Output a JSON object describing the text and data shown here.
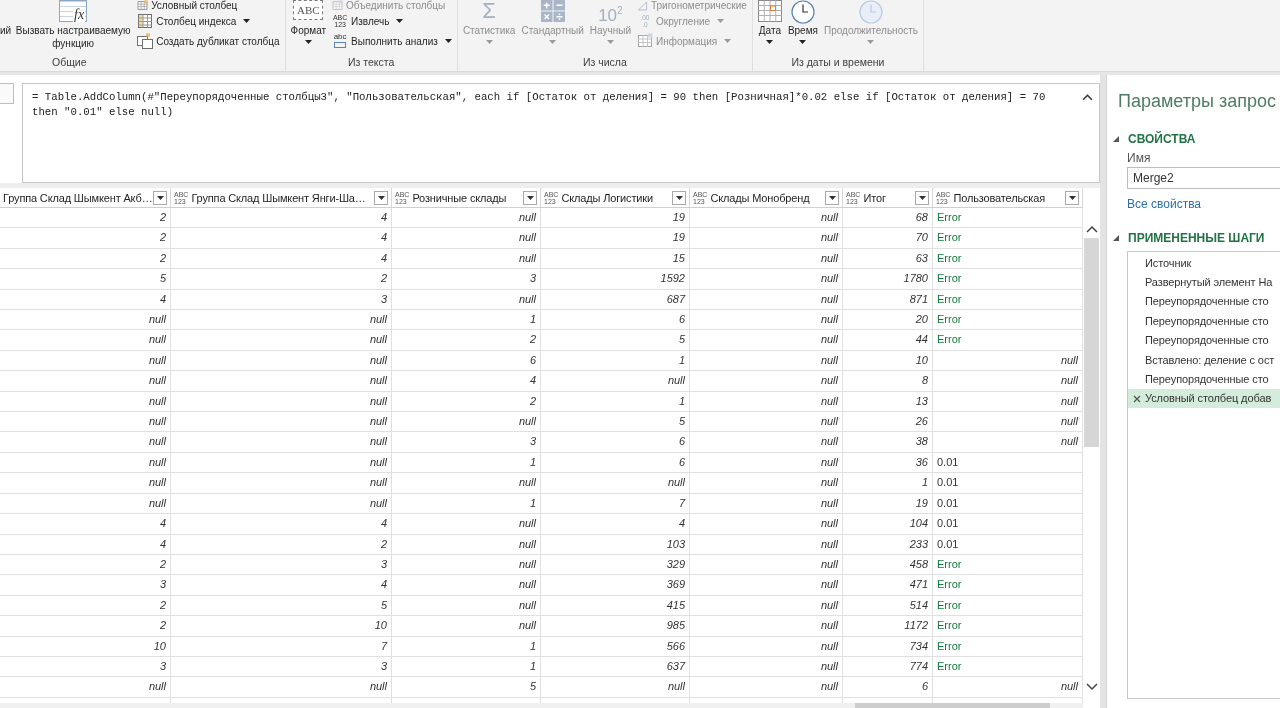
{
  "ribbon": {
    "groups": [
      {
        "label": "Общие",
        "cut_label": "ий",
        "large": [
          {
            "label": "Вызвать настраиваемую функцию",
            "disabled": false,
            "dropdown": false,
            "icon_text": [
              "fx"
            ]
          }
        ],
        "small": [
          {
            "label": "Условный столбец",
            "disabled": false,
            "dropdown": false
          },
          {
            "label": "Столбец индекса",
            "disabled": false,
            "dropdown": true
          },
          {
            "label": "Создать дубликат столбца",
            "disabled": false,
            "dropdown": false
          }
        ]
      },
      {
        "label": "Из текста",
        "large": [
          {
            "label": "Формат",
            "disabled": false,
            "dropdown": true,
            "icon_text": [
              "ABC"
            ]
          }
        ],
        "small": [
          {
            "label": "Объединить столбцы",
            "disabled": true,
            "dropdown": false
          },
          {
            "label": "Извлечь",
            "disabled": false,
            "dropdown": true,
            "icon_text": [
              "ABC",
              "123"
            ]
          },
          {
            "label": "Выполнить анализ",
            "disabled": false,
            "dropdown": true,
            "icon_text": [
              "abc"
            ]
          }
        ]
      },
      {
        "label": "Из числа",
        "large": [
          {
            "label": "Статистика",
            "disabled": true,
            "dropdown": true,
            "icon_text": [
              "Σ"
            ]
          },
          {
            "label": "Стандартный",
            "disabled": true,
            "dropdown": true
          },
          {
            "label": "Научный",
            "disabled": true,
            "dropdown": true,
            "icon_text": [
              "10$^{2}$"
            ]
          }
        ],
        "small": [
          {
            "label": "Тригонометрические",
            "disabled": true,
            "dropdown": false
          },
          {
            "label": "Округление",
            "disabled": true,
            "dropdown": true,
            "icon_text": [
              ".00",
              ".0"
            ]
          },
          {
            "label": "Информация",
            "disabled": true,
            "dropdown": true
          }
        ]
      },
      {
        "label": "Из даты и времени",
        "large": [
          {
            "label": "Дата",
            "disabled": false,
            "dropdown": true
          },
          {
            "label": "Время",
            "disabled": false,
            "dropdown": true
          },
          {
            "label": "Продолжительность",
            "disabled": true,
            "dropdown": true
          }
        ]
      }
    ]
  },
  "formula_bar": {
    "expanded": true,
    "formula": "= Table.AddColumn(#\"Переупорядоченные столбцы3\", \"Пользовательская\", each if [Остаток от деления] = 90 then [Розничная]*0.02 else if [Остаток от деления] = 70 then \"0.01\" else null)"
  },
  "table": {
    "columns": [
      {
        "label": "Группа Склад Шымкент Акб…"
      },
      {
        "label": "Группа Склад Шымкент Янги-Ша…",
        "type_label": [
          "ABC",
          "123"
        ]
      },
      {
        "label": "Розничные склады",
        "type_label": [
          "ABC",
          "123"
        ]
      },
      {
        "label": "Склады Логистики",
        "type_label": [
          "ABC",
          "123"
        ]
      },
      {
        "label": "Склады Монобренд",
        "type_label": [
          "ABC",
          "123"
        ]
      },
      {
        "label": "Итог",
        "type_label": [
          "ABC",
          "123"
        ]
      },
      {
        "label": "Пользовательская",
        "type_label": [
          "ABC",
          "123"
        ]
      }
    ],
    "rows": [
      {
        "cells": [
          "2",
          "4",
          "null",
          "19",
          "null",
          "68"
        ],
        "custom": {
          "kind": "error",
          "value": "Error"
        }
      },
      {
        "cells": [
          "2",
          "4",
          "null",
          "19",
          "null",
          "70"
        ],
        "custom": {
          "kind": "error",
          "value": "Error"
        }
      },
      {
        "cells": [
          "2",
          "4",
          "null",
          "15",
          "null",
          "63"
        ],
        "custom": {
          "kind": "error",
          "value": "Error"
        }
      },
      {
        "cells": [
          "5",
          "2",
          "3",
          "1592",
          "null",
          "1780"
        ],
        "custom": {
          "kind": "error",
          "value": "Error"
        }
      },
      {
        "cells": [
          "4",
          "3",
          "null",
          "687",
          "null",
          "871"
        ],
        "custom": {
          "kind": "error",
          "value": "Error"
        }
      },
      {
        "cells": [
          "null",
          "null",
          "1",
          "6",
          "null",
          "20"
        ],
        "custom": {
          "kind": "error",
          "value": "Error"
        }
      },
      {
        "cells": [
          "null",
          "null",
          "2",
          "5",
          "null",
          "44"
        ],
        "custom": {
          "kind": "error",
          "value": "Error"
        }
      },
      {
        "cells": [
          "null",
          "null",
          "6",
          "1",
          "null",
          "10"
        ],
        "custom": {
          "kind": "null",
          "value": "null"
        }
      },
      {
        "cells": [
          "null",
          "null",
          "4",
          "null",
          "null",
          "8"
        ],
        "custom": {
          "kind": "null",
          "value": "null"
        }
      },
      {
        "cells": [
          "null",
          "null",
          "2",
          "1",
          "null",
          "13"
        ],
        "custom": {
          "kind": "null",
          "value": "null"
        }
      },
      {
        "cells": [
          "null",
          "null",
          "null",
          "5",
          "null",
          "26"
        ],
        "custom": {
          "kind": "null",
          "value": "null"
        }
      },
      {
        "cells": [
          "null",
          "null",
          "3",
          "6",
          "null",
          "38"
        ],
        "custom": {
          "kind": "null",
          "value": "null"
        }
      },
      {
        "cells": [
          "null",
          "null",
          "1",
          "6",
          "null",
          "36"
        ],
        "custom": {
          "kind": "text",
          "value": "0.01"
        }
      },
      {
        "cells": [
          "null",
          "null",
          "null",
          "null",
          "null",
          "1"
        ],
        "custom": {
          "kind": "text",
          "value": "0.01"
        }
      },
      {
        "cells": [
          "null",
          "null",
          "1",
          "7",
          "null",
          "19"
        ],
        "custom": {
          "kind": "text",
          "value": "0.01"
        }
      },
      {
        "cells": [
          "4",
          "4",
          "null",
          "4",
          "null",
          "104"
        ],
        "custom": {
          "kind": "text",
          "value": "0.01"
        }
      },
      {
        "cells": [
          "4",
          "2",
          "null",
          "103",
          "null",
          "233"
        ],
        "custom": {
          "kind": "text",
          "value": "0.01"
        }
      },
      {
        "cells": [
          "2",
          "3",
          "null",
          "329",
          "null",
          "458"
        ],
        "custom": {
          "kind": "error",
          "value": "Error"
        }
      },
      {
        "cells": [
          "3",
          "4",
          "null",
          "369",
          "null",
          "471"
        ],
        "custom": {
          "kind": "error",
          "value": "Error"
        }
      },
      {
        "cells": [
          "2",
          "5",
          "null",
          "415",
          "null",
          "514"
        ],
        "custom": {
          "kind": "error",
          "value": "Error"
        }
      },
      {
        "cells": [
          "2",
          "10",
          "null",
          "985",
          "null",
          "1172"
        ],
        "custom": {
          "kind": "error",
          "value": "Error"
        }
      },
      {
        "cells": [
          "10",
          "7",
          "1",
          "566",
          "null",
          "734"
        ],
        "custom": {
          "kind": "error",
          "value": "Error"
        }
      },
      {
        "cells": [
          "3",
          "3",
          "1",
          "637",
          "null",
          "774"
        ],
        "custom": {
          "kind": "error",
          "value": "Error"
        }
      },
      {
        "cells": [
          "null",
          "null",
          "5",
          "null",
          "null",
          "6"
        ],
        "custom": {
          "kind": "null",
          "value": "null"
        }
      }
    ]
  },
  "query_settings": {
    "title": "Параметры запрос",
    "properties": {
      "heading": "СВОЙСТВА",
      "expanded": true,
      "name_label": "Имя",
      "name_value": "Merge2",
      "all_properties_link": "Все свойства"
    },
    "steps": {
      "heading": "ПРИМЕНЕННЫЕ ШАГИ",
      "expanded": true,
      "items": [
        {
          "label": "Источник",
          "selected": false
        },
        {
          "label": "Развернутый элемент На",
          "selected": false
        },
        {
          "label": "Переупорядоченные сто",
          "selected": false
        },
        {
          "label": "Переупорядоченные сто",
          "selected": false
        },
        {
          "label": "Переупорядоченные сто",
          "selected": false
        },
        {
          "label": "Вставлено: деление с ост",
          "selected": false
        },
        {
          "label": "Переупорядоченные сто",
          "selected": false
        },
        {
          "label": "Условный столбец добав",
          "selected": true
        }
      ]
    }
  }
}
